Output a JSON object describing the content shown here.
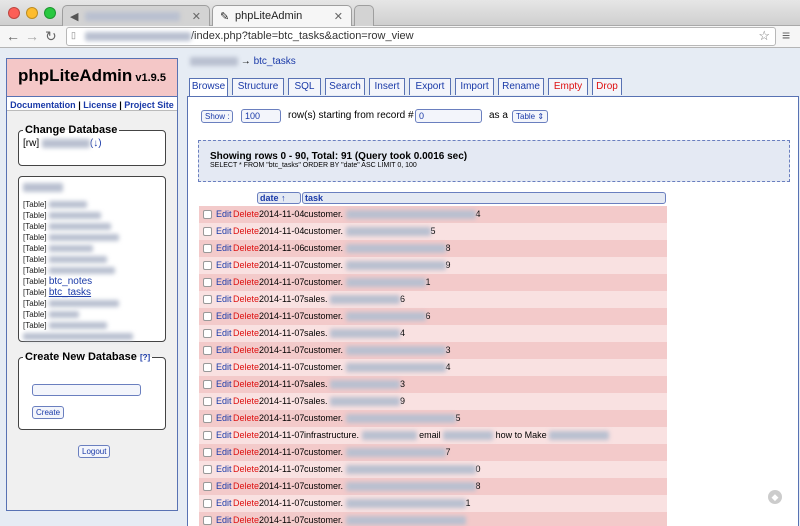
{
  "browser": {
    "tabs": [
      {
        "title": "",
        "active": false
      },
      {
        "title": "phpLiteAdmin",
        "active": true
      }
    ],
    "address": "/index.php?table=btc_tasks&action=row_view"
  },
  "sidebar": {
    "app_name": "phpLiteAdmin",
    "version": "v1.9.5",
    "links": [
      "Documentation",
      "License",
      "Project Site"
    ],
    "change_db_legend": "Change Database",
    "db_prefix": "[rw]",
    "db_suffix": "(↓)",
    "table_tag": "[Table]",
    "visible_tables": [
      "btc_notes",
      "btc_tasks"
    ],
    "create_db_legend": "Create New Database",
    "create_db_help": "[?]",
    "create_button": "Create",
    "logout_button": "Logout"
  },
  "breadcrumb": {
    "arrow": "→",
    "table": "btc_tasks"
  },
  "tabs": [
    "Browse",
    "Structure",
    "SQL",
    "Search",
    "Insert",
    "Export",
    "Import",
    "Rename",
    "Empty",
    "Drop"
  ],
  "browse": {
    "show_button": "Show :",
    "count": "100",
    "mid_text": "row(s) starting from record #",
    "start": "0",
    "as_text": "as a",
    "view_mode": "Table",
    "status": "Showing rows 0 - 90, Total: 91 (Query took 0.0016 sec)",
    "query": "SELECT * FROM \"btc_tasks\" ORDER BY \"date\" ASC LIMIT 0, 100",
    "col_date": "date ↑",
    "col_task": "task",
    "edit_label": "Edit",
    "delete_label": "Delete",
    "rows": [
      {
        "date": "2014-11-04",
        "prefix": "customer.",
        "end": "4",
        "mid": ""
      },
      {
        "date": "2014-11-04",
        "prefix": "customer.",
        "end": "5",
        "mid": ""
      },
      {
        "date": "2014-11-06",
        "prefix": "customer.",
        "end": "8",
        "mid": ""
      },
      {
        "date": "2014-11-07",
        "prefix": "customer.",
        "end": "9",
        "mid": ""
      },
      {
        "date": "2014-11-07",
        "prefix": "customer.",
        "end": "1",
        "mid": ""
      },
      {
        "date": "2014-11-07",
        "prefix": "sales.",
        "end": "6",
        "mid": ""
      },
      {
        "date": "2014-11-07",
        "prefix": "customer.",
        "end": "6",
        "mid": ""
      },
      {
        "date": "2014-11-07",
        "prefix": "sales.",
        "end": "4",
        "mid": ""
      },
      {
        "date": "2014-11-07",
        "prefix": "customer.",
        "end": "3",
        "mid": ""
      },
      {
        "date": "2014-11-07",
        "prefix": "customer.",
        "end": "4",
        "mid": ""
      },
      {
        "date": "2014-11-07",
        "prefix": "sales.",
        "end": "3",
        "mid": ""
      },
      {
        "date": "2014-11-07",
        "prefix": "sales.",
        "end": "9",
        "mid": ""
      },
      {
        "date": "2014-11-07",
        "prefix": "customer.",
        "end": "5",
        "mid": ""
      },
      {
        "date": "2014-11-07",
        "prefix": "infrastructure.",
        "end": "",
        "mid": "email",
        "mid2": "how to Make"
      },
      {
        "date": "2014-11-07",
        "prefix": "customer.",
        "end": "7",
        "mid": ""
      },
      {
        "date": "2014-11-07",
        "prefix": "customer.",
        "end": "0",
        "mid": ""
      },
      {
        "date": "2014-11-07",
        "prefix": "customer.",
        "end": "8",
        "mid": ""
      },
      {
        "date": "2014-11-07",
        "prefix": "customer.",
        "end": "1",
        "mid": ""
      },
      {
        "date": "2014-11-07",
        "prefix": "customer.",
        "end": "",
        "mid": ""
      }
    ]
  },
  "colors": {
    "accent": "#5872b3",
    "link": "#1a3aa8",
    "danger": "#dd1111",
    "row_odd": "#f3caca",
    "row_even": "#f9e1e1",
    "title_bg": "#f4c7c7"
  }
}
